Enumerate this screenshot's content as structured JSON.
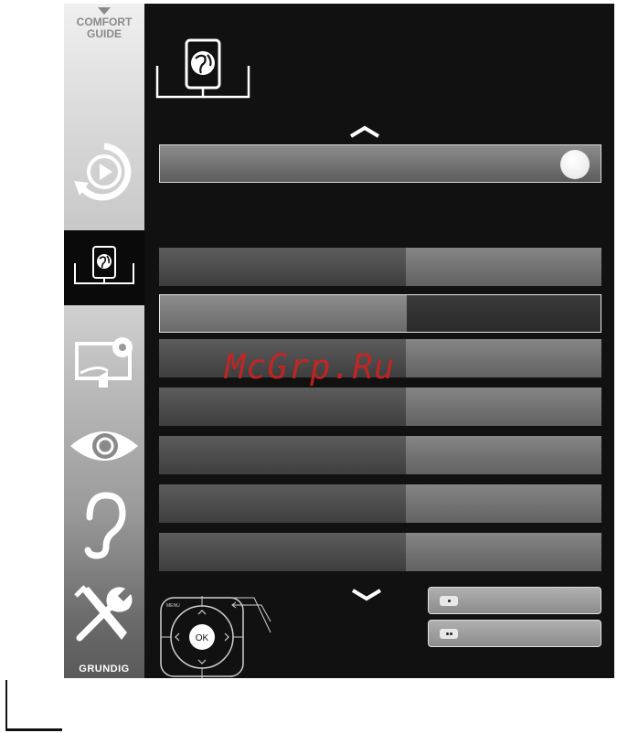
{
  "sidebar": {
    "comfort_guide": "COMFORT\nGUIDE",
    "brand": "GRUNDIG",
    "items": [
      {
        "icon": "source-play-icon"
      },
      {
        "icon": "network-globe-icon",
        "selected": true
      },
      {
        "icon": "picture-settings-icon"
      },
      {
        "icon": "eye-icon"
      },
      {
        "icon": "ear-sound-icon"
      },
      {
        "icon": "tools-icon"
      }
    ]
  },
  "header": {
    "icon": "network-globe-icon"
  },
  "remote": {
    "ok_label": "OK",
    "menu_label": "MENU"
  },
  "watermark": "McGrp.Ru",
  "colors": {
    "accent_text": "#d42020",
    "panel_bg": "#111111"
  }
}
